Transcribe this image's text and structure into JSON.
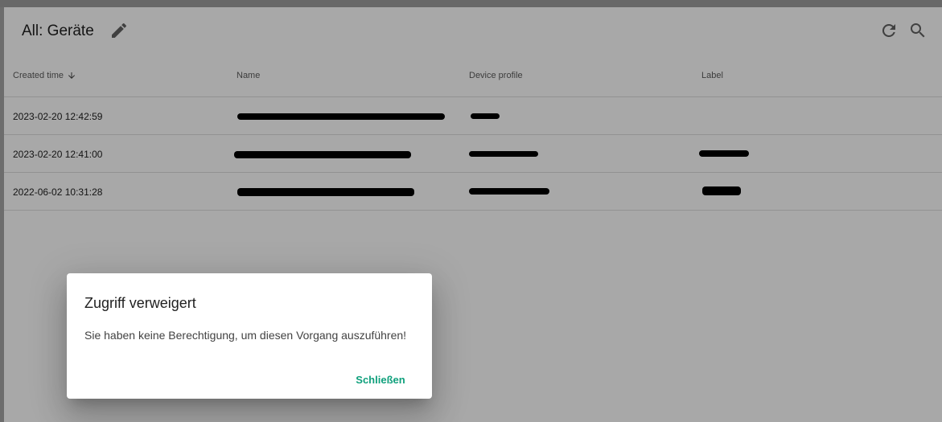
{
  "header": {
    "title": "All: Geräte"
  },
  "icons": {
    "edit": "pencil-icon",
    "refresh": "refresh-icon",
    "search": "search-icon",
    "sort": "arrow-down-icon"
  },
  "table": {
    "columns": [
      {
        "label": "Created time",
        "sorted": "descending"
      },
      {
        "label": "Name"
      },
      {
        "label": "Device profile"
      },
      {
        "label": "Label"
      }
    ],
    "rows": [
      {
        "created": "2023-02-20 12:42:59",
        "name": "[redacted]",
        "profile": "[redacted]",
        "label": ""
      },
      {
        "created": "2023-02-20 12:41:00",
        "name": "[redacted]",
        "profile": "[redacted]",
        "label": "[redacted]"
      },
      {
        "created": "2022-06-02 10:31:28",
        "name": "[redacted]",
        "profile": "[redacted]",
        "label": "[redacted]"
      }
    ]
  },
  "dialog": {
    "title": "Zugriff verweigert",
    "message": "Sie haben keine Berechtigung, um diesen Vorgang auszuführen!",
    "close_label": "Schließen"
  },
  "colors": {
    "accent": "#0fa07c",
    "overlay": "rgba(0,0,0,0.34)"
  }
}
